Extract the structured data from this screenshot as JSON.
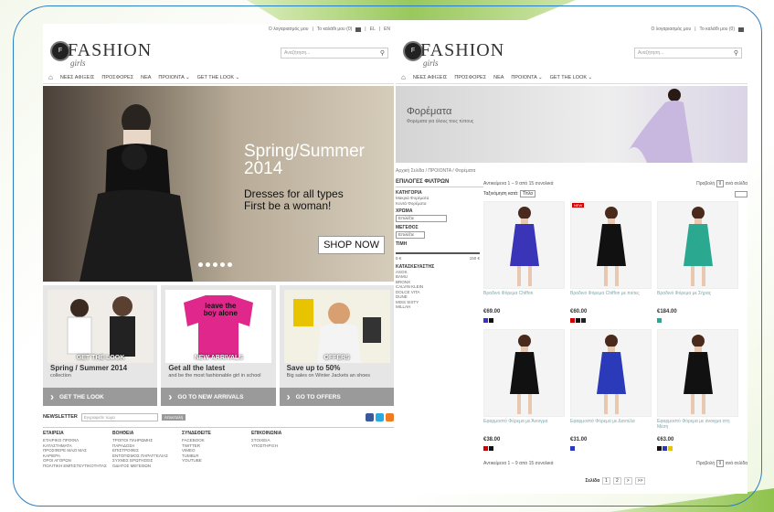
{
  "left": {
    "topbar": {
      "account": "Ο λογαριασμός μου",
      "cart": "Το καλάθι μου (0)",
      "lang_el": "EL",
      "lang_en": "EN"
    },
    "brand": {
      "name": "FASHION",
      "sub": "girls",
      "mark": "F"
    },
    "search": {
      "placeholder": "Αναζήτηση..."
    },
    "nav": [
      "ΝΕΕΣ ΑΦΙΞΕΙΣ",
      "ΠΡΟΣΦΟΡΕΣ",
      "ΝΕΑ",
      "ΠΡΟΙΟΝΤΑ",
      "GET THE LOOK"
    ],
    "hero": {
      "line1": "Spring/Summer",
      "line2": "2014",
      "line3": "Dresses for all types",
      "line4": "First be a woman!",
      "cta": "SHOP NOW"
    },
    "tiles": [
      {
        "caption": "GET THE LOOK",
        "title": "Spring / Summer 2014",
        "text": "collection",
        "button": "GET THE LOOK"
      },
      {
        "caption": "NEW ARRIVALS",
        "title": "Get all the latest",
        "text": "and be the most fashionable girl in school",
        "button": "GO TO NEW ARRIVALS",
        "shirt_text": "leave the boy alone"
      },
      {
        "caption": "OFFERS",
        "title": "Save up to 50%",
        "text": "Big sales on Winter Jackets an shoes",
        "button": "GO TO OFFERS"
      }
    ],
    "newsletter": {
      "label": "NEWSLETTER",
      "placeholder": "Εγγραφείτε τώρα",
      "button": "Αποστολή"
    },
    "footer": [
      {
        "title": "ΕΤΑΙΡΕΙΑ",
        "items": [
          "ΕΤΑΙΡΙΚΟ ΠΡΟΦΙΛ",
          "ΚΑΤΑΣΤΗΜΑΤΑ",
          "ΠΡΟΣΦΕΡΕ ΜΑΖΙ ΜΑΣ",
          "ΚΑΡΙΕΡΑ",
          "ΟΡΟΙ ΑΓΟΡΩΝ",
          "ΠΟΛΙΤΙΚΗ ΕΜΠΙΣΤΕΥΤΙΚΟΤΗΤΑΣ"
        ]
      },
      {
        "title": "ΒΟΗΘΕΙΑ",
        "items": [
          "ΤΡΟΠΟΙ ΠΛΗΡΩΜΗΣ",
          "ΠΑΡΑΔΟΣΗ",
          "ΕΠΙΣΤΡΟΦΕΣ",
          "ΕΝΤΟΠΙΣΜΟΣ ΠΑΡΑΓΓΕΛΙΑΣ",
          "ΣΥΧΝΕΣ ΕΡΩΤΗΣΕΙΣ",
          "ΟΔΗΓΟΣ ΜΕΓΕΘΩΝ"
        ]
      },
      {
        "title": "ΣΥΝΔΕΘΕΙΤΕ",
        "items": [
          "FACEBOOK",
          "TWITTER",
          "VIMEO",
          "TUMBLR",
          "YOUTUBE"
        ]
      },
      {
        "title": "ΕΠΙΚΟΙΝΩΝΙΑ",
        "items": [
          "ΣΤΟΙΧΕΙΑ",
          "ΥΠΟΣΤΗΡΙΞΗ"
        ]
      }
    ]
  },
  "right": {
    "topbar": {
      "account": "Ο λογαριασμός μου",
      "cart": "Το καλάθι μου (0)"
    },
    "brand": {
      "name": "FASHION",
      "sub": "girls",
      "mark": "F"
    },
    "search": {
      "placeholder": "Αναζήτηση..."
    },
    "nav": [
      "ΝΕΕΣ ΑΦΙΞΕΙΣ",
      "ΠΡΟΣΦΟΡΕΣ",
      "ΝΕΑ",
      "ΠΡΟΙΟΝΤΑ",
      "GET THE LOOK"
    ],
    "banner": {
      "title": "Φορέματα",
      "subtitle": "Φορέματα για όλους τους τύπους"
    },
    "breadcrumb": "Αρχική Σελίδα / ΠΡΟΙΟΝΤΑ / Φορέματα",
    "filters": {
      "title": "ΕΠΙΛΟΓΕΣ ΦΙΛΤΡΩΝ",
      "category_label": "ΚΑΤΗΓΟΡΙΑ",
      "categories": [
        "Μακριά Φορέματα",
        "Κοντά Φορέματα"
      ],
      "color_label": "ΧΡΩΜΑ",
      "color_value": "Επιλέξτε",
      "size_label": "ΜΕΓΕΘΟΣ",
      "size_value": "Επιλέξτε",
      "price_label": "ΤΙΜΗ",
      "price_min": "5 €",
      "price_max": "150 €",
      "maker_label": "ΚΑΤΑΣΚΕΥΑΣΤΗΣ",
      "makers": [
        "ASOS",
        "BAMU",
        "BRONX",
        "CALVIN KLEIN",
        "DOLCE VITA",
        "DUNE",
        "MISS SIXTY",
        "MILLAH"
      ]
    },
    "products": {
      "count_text": "Αντικείμενα 1 – 9 από 15 συνολικά",
      "per_page": "Προβολή",
      "per_page_value": "9",
      "per_page_suffix": "ανά σελίδα",
      "sort_label": "Ταξινόμηση κατά:",
      "sort_value": "Τίτλο",
      "new_badge": "NEW",
      "items": [
        {
          "name": "Βραδινό Φόρεμα Chiffon",
          "price": "€69.00"
        },
        {
          "name": "Βραδινό Φόρεμα Chiffon με πιέτες",
          "price": "€60.00"
        },
        {
          "name": "Βραδινό Φόρεμα με Σήρας",
          "price": "€184.00"
        },
        {
          "name": "Εφαρμοστό Φόρεμα με Άνοιγμα",
          "price": "€38.00"
        },
        {
          "name": "Εφαρμοστό Φόρεμα με Δαντέλα",
          "price": "€31.00"
        },
        {
          "name": "Εφαρμοστό Φόρεμα με άνοιγμα στη Μέση",
          "price": "€63.00"
        }
      ],
      "pager_label": "Σελίδα",
      "pages": [
        "1",
        "2",
        ">",
        ">>"
      ]
    }
  },
  "colors": {
    "accent": "#8dc24a",
    "frame": "#2a7fc4",
    "tile_button": "#9a9a9a"
  }
}
